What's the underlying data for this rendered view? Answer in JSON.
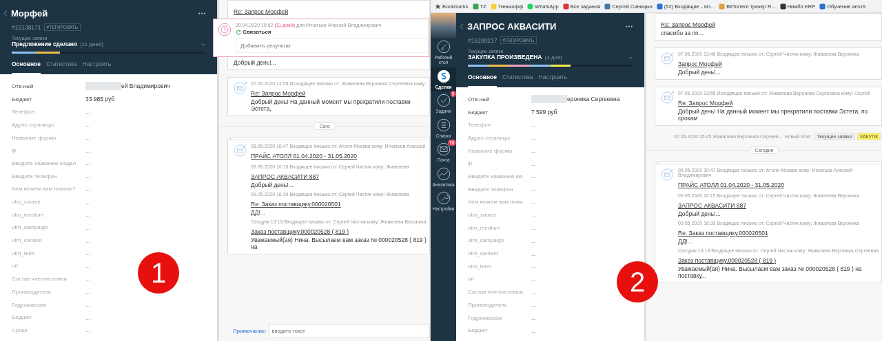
{
  "panes": [
    {
      "marker": "1",
      "card": {
        "title": "Морфей",
        "id": "#15138171",
        "tag_button": "#ТЕГИРОВАТЬ",
        "pipeline": "Текущие заявки",
        "stage": "Предложение сделано",
        "stage_duration": "(11 дней)",
        "segments": [
          {
            "color": "#8fc3f0"
          },
          {
            "color": "#f3bd4c"
          }
        ],
        "tabs": [
          {
            "label": "Основное",
            "selected": true
          },
          {
            "label": "Статистика",
            "selected": false
          },
          {
            "label": "Настроить",
            "selected": false
          }
        ],
        "fields": [
          {
            "label": "Отв-ный",
            "value": "ей Владимирович",
            "empty": false,
            "redacted": true
          },
          {
            "label": "Бюджет",
            "value": "33 985 руб",
            "empty": false,
            "redacted": false
          },
          {
            "label": "Телефон",
            "value": "...",
            "empty": true,
            "redacted": false
          },
          {
            "label": "Адрес страницы",
            "value": "...",
            "empty": true,
            "redacted": false
          },
          {
            "label": "Название формы",
            "value": "...",
            "empty": true,
            "redacted": false
          },
          {
            "label": "ip",
            "value": "...",
            "empty": true,
            "redacted": false
          },
          {
            "label": "Введите название модел",
            "value": "...",
            "empty": true,
            "redacted": false
          },
          {
            "label": "Введите телефон",
            "value": "...",
            "empty": true,
            "redacted": false
          },
          {
            "label": "Чем можем вам помочь?",
            "value": "...",
            "empty": true,
            "redacted": false
          },
          {
            "label": "utm_source",
            "value": "...",
            "empty": true,
            "redacted": false
          },
          {
            "label": "utm_medium",
            "value": "...",
            "empty": true,
            "redacted": false
          },
          {
            "label": "utm_campaign",
            "value": "...",
            "empty": true,
            "redacted": false
          },
          {
            "label": "utm_content",
            "value": "...",
            "empty": true,
            "redacted": false
          },
          {
            "label": "utm_term",
            "value": "...",
            "empty": true,
            "redacted": false
          },
          {
            "label": "url",
            "value": "...",
            "empty": true,
            "redacted": false
          },
          {
            "label": "Состав членов семьи",
            "value": "...",
            "empty": true,
            "redacted": false
          },
          {
            "label": "Производитель",
            "value": "...",
            "empty": true,
            "redacted": false
          },
          {
            "label": "Гидромассаж",
            "value": "...",
            "empty": true,
            "redacted": false
          },
          {
            "label": "Бюджет",
            "value": "...",
            "empty": true,
            "redacted": false
          },
          {
            "label": "Сроки",
            "value": "...",
            "empty": true,
            "redacted": false
          }
        ]
      },
      "feed": [
        {
          "kind": "mail",
          "stacked": false,
          "entries": [
            {
              "subject": "Re: Запрос Морфей",
              "task": {
                "date": "30.04.2020 10:52",
                "overdue": "(11 дней)",
                "for": "для Игнатьев Алексей Владимирович",
                "title": "Связаться",
                "placeholder": "Добавить результат"
              },
              "preview": "Добрый день!..."
            }
          ]
        },
        {
          "kind": "outgoing",
          "stacked": false,
          "entries": [
            {
              "meta": "07.05.2020 13:55 Исходящее письмо от: Живалева Вероника Сергеевна кому:",
              "subject": "Re: Запрос Морфей",
              "preview": "Добрый день! На данный момент мы прекратили поставки Эстета,"
            }
          ]
        },
        {
          "kind": "date",
          "label": "Сего"
        },
        {
          "kind": "incoming",
          "stacked": true,
          "entries": [
            {
              "meta": "08.05.2020 10:47 Входящее письмо от: Атолл Москва кому: Игнатьев Алексей",
              "subject": "ПРАЙС АТОЛЛ 01.04.2020 - 31.05.2020"
            },
            {
              "meta": "09.05.2020 10:15 Входящее письмо от: Сергей Чистик кому: Живалева",
              "subject": "ЗАПРОС АКВАСИТИ 887",
              "preview": "Добрый день!..."
            },
            {
              "meta": "09.05.2020 16:39 Входящее письмо от: Сергей Чистик кому: Живалева",
              "subject": "Re: Заказ поставщику.000020501",
              "preview": "ДД!..."
            },
            {
              "meta": "Сегодня 13:13 Входящее письмо от: Сергей Чистик кому: Живалева Вероника",
              "subject": "Заказ поставщику.000020528 ( 819 )",
              "preview": "Уважаемый(ая) Нина. Высылаем вам заказ № 000020528 ( 819 ) на"
            }
          ]
        }
      ],
      "note": {
        "label": "Примечание:",
        "placeholder": "введите текст"
      }
    },
    {
      "marker": "2",
      "bookmarks": [
        "Bookmarks",
        "TZ",
        "Тинькофф",
        "WhatsApp",
        "Все задания",
        "Сергей Синицын",
        "(52) Входящие - sin...",
        "BitTorrent трекер R...",
        "Нимбл ERP",
        "Обучение amoS"
      ],
      "nav": [
        {
          "label": "Рабочий стол",
          "selected": false
        },
        {
          "label": "Сделки",
          "selected": true
        },
        {
          "label": "Задачи",
          "selected": false,
          "badge": "9"
        },
        {
          "label": "Списки",
          "selected": false
        },
        {
          "label": "Почта",
          "selected": false,
          "badge": "76"
        },
        {
          "label": "Аналитика",
          "selected": false
        },
        {
          "label": "Настройки",
          "selected": false
        }
      ],
      "card": {
        "title": "ЗАПРОС АКВАСИТИ",
        "id": "#15280217",
        "tag_button": "#ТЕГИРОВАТЬ",
        "pipeline": "Текущие заявки",
        "stage": "ЗАКУПКА ПРОИЗВЕДЕНА",
        "stage_duration": "(3 дня)",
        "segments": [
          {
            "color": "#8fc3f0"
          },
          {
            "color": "#f3bd4c"
          },
          {
            "color": "#f5a3c0"
          },
          {
            "color": "#8fc3f0"
          },
          {
            "color": "#f5ec4c"
          }
        ],
        "tabs": [
          {
            "label": "Основное",
            "selected": true
          },
          {
            "label": "Статистика",
            "selected": false
          },
          {
            "label": "Настроить",
            "selected": false
          }
        ],
        "fields": [
          {
            "label": "Отв-ный",
            "value": "ероника Сергеевна",
            "empty": false,
            "redacted": true
          },
          {
            "label": "Бюджет",
            "value": "7 599 руб",
            "empty": false,
            "redacted": false
          },
          {
            "label": "Телефон",
            "value": "...",
            "empty": true,
            "redacted": false
          },
          {
            "label": "Адрес страницы",
            "value": "...",
            "empty": true,
            "redacted": false
          },
          {
            "label": "Название формы",
            "value": "...",
            "empty": true,
            "redacted": false
          },
          {
            "label": "ip",
            "value": "...",
            "empty": true,
            "redacted": false
          },
          {
            "label": "Введите название мо",
            "value": "...",
            "empty": true,
            "redacted": false
          },
          {
            "label": "Введите телефон",
            "value": "...",
            "empty": true,
            "redacted": false
          },
          {
            "label": "Чем можем вам помо",
            "value": "...",
            "empty": true,
            "redacted": false
          },
          {
            "label": "utm_source",
            "value": "...",
            "empty": true,
            "redacted": false
          },
          {
            "label": "utm_medium",
            "value": "...",
            "empty": true,
            "redacted": false
          },
          {
            "label": "utm_campaign",
            "value": "...",
            "empty": true,
            "redacted": false
          },
          {
            "label": "utm_content",
            "value": "...",
            "empty": true,
            "redacted": false
          },
          {
            "label": "utm_term",
            "value": "...",
            "empty": true,
            "redacted": false
          },
          {
            "label": "url",
            "value": "...",
            "empty": true,
            "redacted": false
          },
          {
            "label": "Состав членов семьи",
            "value": "...",
            "empty": true,
            "redacted": false
          },
          {
            "label": "Производитель",
            "value": "...",
            "empty": true,
            "redacted": false
          },
          {
            "label": "Гидромассаж",
            "value": "...",
            "empty": true,
            "redacted": false
          },
          {
            "label": "Бюджет",
            "value": "...",
            "empty": true,
            "redacted": false
          }
        ]
      },
      "feed": [
        {
          "kind": "mail",
          "stacked": false,
          "entries": [
            {
              "subject": "Re: Запрос Морфей",
              "preview": "спасибо за пп..."
            }
          ]
        },
        {
          "kind": "incoming",
          "stacked": false,
          "entries": [
            {
              "meta": "07.05.2020 13:46 Входящее письмо от: Сергей Чистик кому: Живалева Вероника",
              "subject": "Запрос Морфей",
              "preview": "Добрый день!..."
            }
          ]
        },
        {
          "kind": "outgoing",
          "stacked": false,
          "entries": [
            {
              "meta": "07.05.2020 13:55 Исходящее письмо от: Живалева Вероника Сергеевна кому: Сергей",
              "subject": "Re: Запрос Морфей",
              "preview": "Добрый день! На данный момент мы прекратили поставки Эстета, по срокам"
            }
          ]
        },
        {
          "kind": "stage",
          "meta": "07.05.2020 15:45 Живалева Вероника Сергеев...",
          "label": "Новый этап:",
          "pipeline": "Текущие заявки",
          "stage": "ЗАКУПК",
          "color": "#fff35c"
        },
        {
          "kind": "date",
          "label": "Сегодня"
        },
        {
          "kind": "incoming",
          "stacked": true,
          "entries": [
            {
              "meta": "08.05.2020 10:47 Входящее письмо от: Атолл Москва кому: Игнатьев Алексей Владимирович",
              "subject": "ПРАЙС АТОЛЛ 01.04.2020 - 31.05.2020"
            },
            {
              "meta": "09.05.2020 10:15 Входящее письмо от: Сергей Чистик кому: Живалева Вероника",
              "subject": "ЗАПРОС АКВАСИТИ 887",
              "preview": "Добрый день!..."
            },
            {
              "meta": "09.05.2020 16:39 Входящее письмо от: Сергей Чистик кому: Живалева Вероника",
              "subject": "Re: Заказ поставщику.000020501",
              "preview": "ДД!..."
            },
            {
              "meta": "Сегодня 13:13 Входящее письмо от: Сергей Чистик кому: Живалева Вероника Сергеевна",
              "subject": "Заказ поставщику.000020528 ( 819 )",
              "preview": "Уважаемый(ая) Нина. Высылаем вам заказ № 000020528 ( 819 ) на поставку..."
            }
          ]
        }
      ]
    }
  ]
}
